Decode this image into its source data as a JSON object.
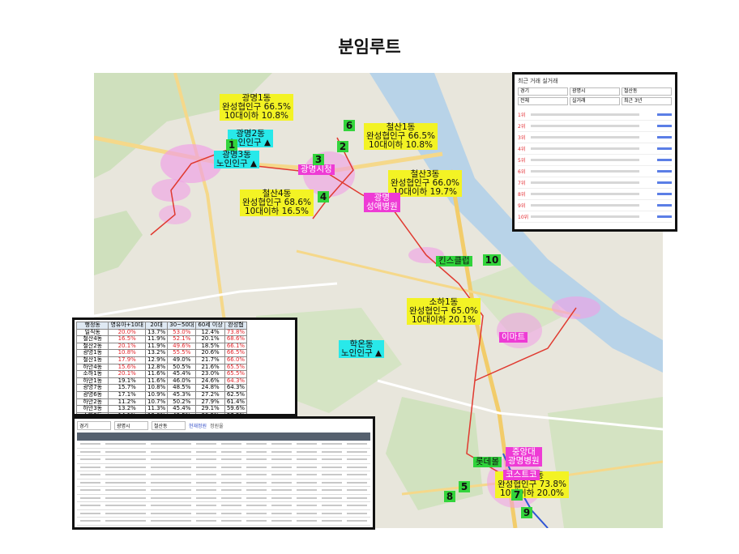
{
  "title": "분임루트",
  "map_labels": {
    "gwangmyeong1": {
      "name": "광명1동",
      "line1": "완성협인구 66.5%",
      "line2": "10대이하 10.8%"
    },
    "gwangmyeong2": {
      "name": "광명2동",
      "line1": "노인인구 ▲"
    },
    "gwangmyeong3": {
      "name": "광명3동",
      "line1": "노인인구 ▲"
    },
    "cheolsan1": {
      "name": "철산1동",
      "line1": "완성협인구 66.5%",
      "line2": "10대이하 10.8%"
    },
    "cheolsan3": {
      "name": "철산3동",
      "line1": "완성협인구 66.0%",
      "line2": "10대이하 19.7%"
    },
    "cheolsan4": {
      "name": "철산4동",
      "line1": "완성협인구 68.6%",
      "line2": "10대이하 16.5%"
    },
    "soha1": {
      "name": "소하1동",
      "line1": "완성협인구 65.0%",
      "line2": "10대이하 20.1%"
    },
    "hagon": {
      "name": "학온동",
      "line1": "노인인구 ▲"
    },
    "iljik": {
      "name": "일직동",
      "line1": "완성협인구 73.8%",
      "line2": "10대이하 20.0%"
    },
    "city_hall": "광명시청",
    "hospital_left": "광명\n성애병원",
    "costco": "킨스클럽",
    "emart": "이마트",
    "hospital_bottom": "중앙대\n광명병원",
    "lotte": "롯데몰",
    "costco2": "코스트코"
  },
  "route_numbers": [
    "1",
    "2",
    "3",
    "4",
    "5",
    "6",
    "7",
    "8",
    "9",
    "10"
  ],
  "top_right_panel": {
    "header": "최근 거래 실거래",
    "filters": [
      "경기",
      "광명시",
      "철산동",
      "전체",
      "실거래",
      "최근 3년"
    ],
    "rows": [
      "1위",
      "2위",
      "3위",
      "4위",
      "5위",
      "6위",
      "7위",
      "8위",
      "9위",
      "10위"
    ]
  },
  "stats_table": {
    "headers": [
      "행정동",
      "영유아+10대",
      "20대",
      "30~50대",
      "60세 이상",
      "완성협"
    ],
    "rows": [
      [
        "일직동",
        "20.0%",
        "13.7%",
        "53.0%",
        "12.4%",
        "73.8%"
      ],
      [
        "철산4동",
        "16.5%",
        "11.9%",
        "52.1%",
        "20.1%",
        "68.6%"
      ],
      [
        "철산2동",
        "20.1%",
        "11.9%",
        "49.6%",
        "18.5%",
        "66.1%"
      ],
      [
        "광명1동",
        "10.8%",
        "13.2%",
        "55.5%",
        "20.6%",
        "66.5%"
      ],
      [
        "철산1동",
        "17.9%",
        "12.9%",
        "49.0%",
        "21.7%",
        "66.0%"
      ],
      [
        "하안4동",
        "15.6%",
        "12.8%",
        "50.5%",
        "21.6%",
        "65.5%"
      ],
      [
        "소하1동",
        "20.1%",
        "11.6%",
        "45.4%",
        "23.0%",
        "65.5%"
      ],
      [
        "하안1동",
        "19.1%",
        "11.6%",
        "46.0%",
        "24.6%",
        "64.3%"
      ],
      [
        "광명7동",
        "15.7%",
        "10.8%",
        "48.5%",
        "24.8%",
        "64.3%"
      ],
      [
        "광명6동",
        "17.1%",
        "10.9%",
        "45.3%",
        "27.2%",
        "62.5%"
      ],
      [
        "하안2동",
        "11.2%",
        "10.7%",
        "50.2%",
        "27.9%",
        "61.4%"
      ],
      [
        "하안3동",
        "13.2%",
        "11.3%",
        "45.4%",
        "29.1%",
        "59.6%"
      ],
      [
        "소하2동",
        "14.1%",
        "12.0%",
        "43.5%",
        "30.5%",
        "57.5%"
      ],
      [
        "광명5동",
        "12.9%",
        "10.9%",
        "42.4%",
        "32.7%",
        "55.3%"
      ],
      [
        "광명4동",
        "9.9%",
        "9.9%",
        "41.4%",
        "38.7%",
        "51.3%"
      ],
      [
        "광명2동",
        "7.8%",
        "13.0%",
        "43.1%",
        "36.1%",
        "50.9%"
      ],
      [
        "광명3동",
        "8.3%",
        "10.5%",
        "41.3%",
        "39.9%",
        "49.6%"
      ],
      [
        "광명2동",
        "8.2%",
        "10.1%",
        "40.7%",
        "40.9%",
        "48.9%"
      ],
      [
        "학온동",
        "5.6%",
        "7.4%",
        "35.5%",
        "51.5%",
        "41.1%"
      ],
      [
        "광명시 합계",
        "16.1%",
        "11.5%",
        "46.7%",
        "25.7%",
        "62.8%"
      ]
    ]
  },
  "bottom_panel": {
    "filters": [
      "경기",
      "광명시",
      "철산동"
    ],
    "legend": [
      "현재정원",
      "정원율"
    ],
    "row_count": 12
  }
}
